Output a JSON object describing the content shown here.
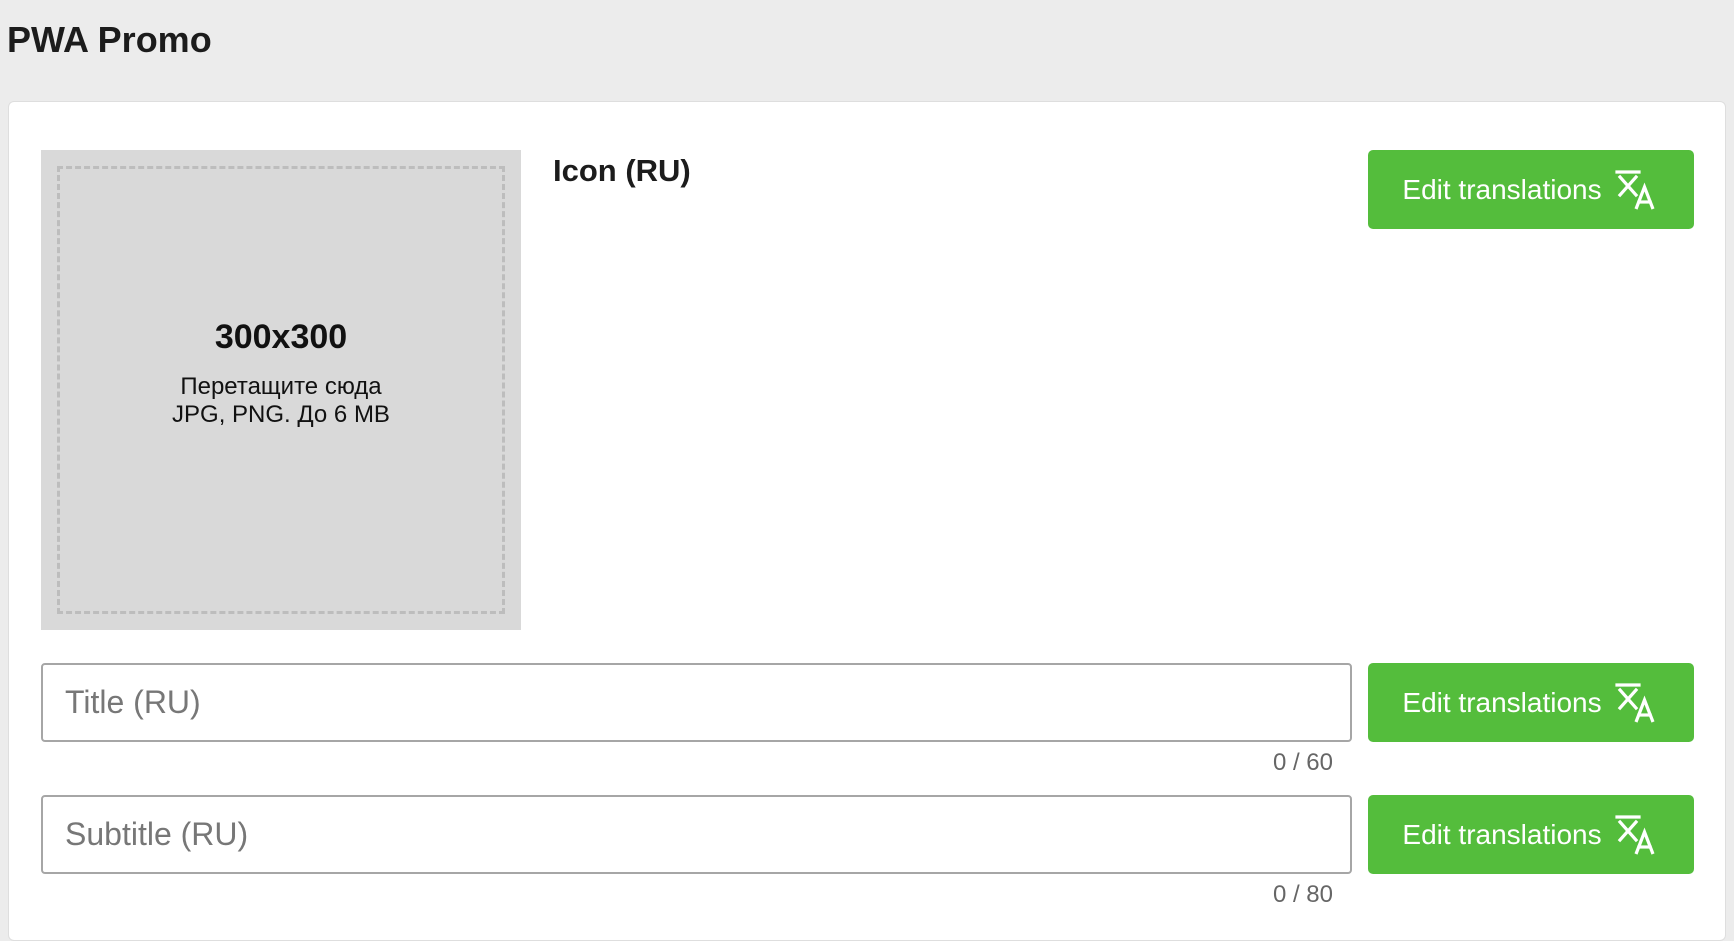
{
  "page": {
    "title": "PWA Promo"
  },
  "icon_section": {
    "label": "Icon (RU)",
    "dropzone": {
      "size": "300x300",
      "hint": "Перетащите сюда",
      "formats": "JPG, PNG. До 6 MB"
    },
    "translate_button": "Edit translations"
  },
  "title_field": {
    "placeholder": "Title (RU)",
    "value": "",
    "counter": "0 / 60",
    "translate_button": "Edit translations"
  },
  "subtitle_field": {
    "placeholder": "Subtitle (RU)",
    "value": "",
    "counter": "0 / 80",
    "translate_button": "Edit translations"
  },
  "colors": {
    "accent": "#54bd3c",
    "background": "#ececec",
    "card": "#ffffff",
    "dropzone": "#d9d9d9"
  },
  "icons": {
    "translate": "translate-icon"
  }
}
